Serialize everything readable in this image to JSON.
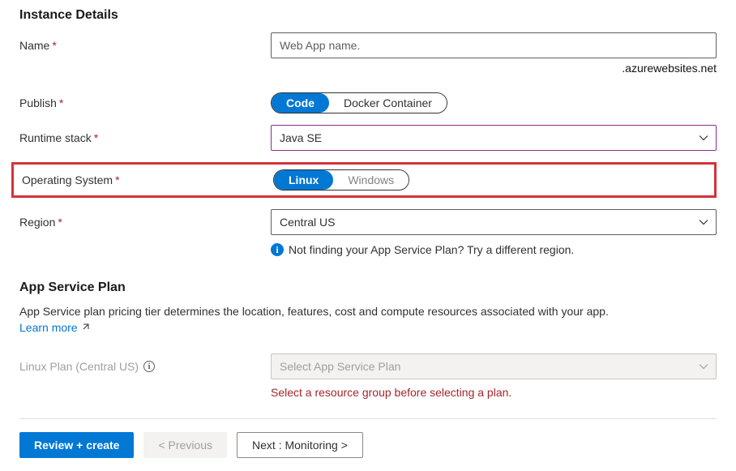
{
  "sections": {
    "instance": {
      "title": "Instance Details",
      "name": {
        "label": "Name",
        "placeholder": "Web App name.",
        "suffix": ".azurewebsites.net"
      },
      "publish": {
        "label": "Publish",
        "option_selected": "Code",
        "option_other": "Docker Container"
      },
      "runtime": {
        "label": "Runtime stack",
        "value": "Java SE"
      },
      "os": {
        "label": "Operating System",
        "option_selected": "Linux",
        "option_other": "Windows"
      },
      "region": {
        "label": "Region",
        "value": "Central US",
        "info": "Not finding your App Service Plan? Try a different region."
      }
    },
    "plan": {
      "title": "App Service Plan",
      "description": "App Service plan pricing tier determines the location, features, cost and compute resources associated with your app.",
      "learn_more": "Learn more",
      "linux_plan_label": "Linux Plan (Central US)",
      "linux_plan_placeholder": "Select App Service Plan",
      "error": "Select a resource group before selecting a plan."
    }
  },
  "footer": {
    "review": "Review + create",
    "previous": "< Previous",
    "next": "Next : Monitoring >"
  }
}
